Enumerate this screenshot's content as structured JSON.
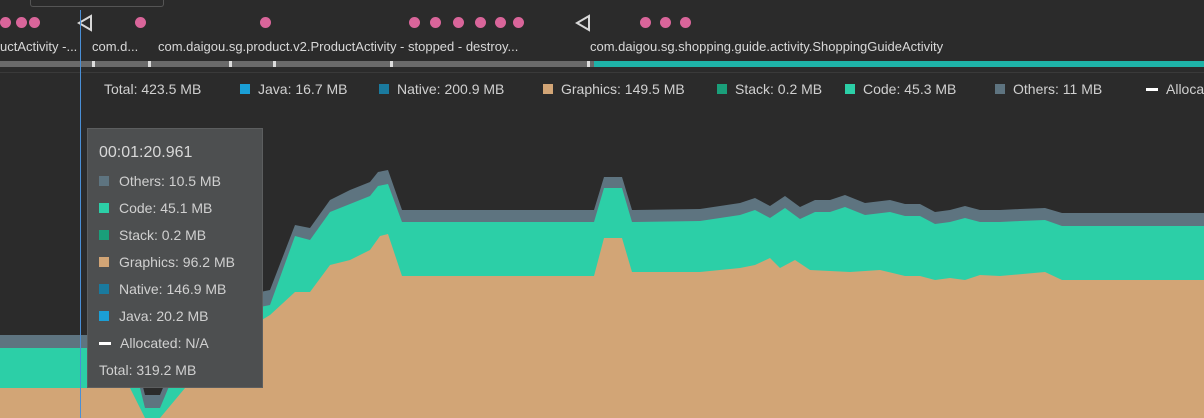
{
  "activities": [
    {
      "label": "uctActivity -..."
    },
    {
      "label": "com.d..."
    },
    {
      "label": "com.daigou.sg.product.v2.ProductActivity - stopped - destroy..."
    },
    {
      "label": "com.daigou.sg.shopping.guide.activity.ShoppingGuideActivity"
    }
  ],
  "legend": [
    {
      "label": "Total: 423.5 MB",
      "color": ""
    },
    {
      "label": "Java: 16.7 MB",
      "color": "#1a9fd6"
    },
    {
      "label": "Native: 200.9 MB",
      "color": "#1a7a9e"
    },
    {
      "label": "Graphics: 149.5 MB",
      "color": "#d2a576"
    },
    {
      "label": "Stack: 0.2 MB",
      "color": "#1a9f7a"
    },
    {
      "label": "Code: 45.3 MB",
      "color": "#2ccfa7"
    },
    {
      "label": "Others: 11 MB",
      "color": "#5e7480"
    },
    {
      "label": "Alloca",
      "color": "#ffffff"
    }
  ],
  "tooltip": {
    "time": "00:01:20.961",
    "rows": [
      {
        "label": "Others: 10.5 MB",
        "color": "#5e7480"
      },
      {
        "label": "Code: 45.1 MB",
        "color": "#2ccfa7"
      },
      {
        "label": "Stack: 0.2 MB",
        "color": "#1a9f7a"
      },
      {
        "label": "Graphics: 96.2 MB",
        "color": "#d2a576"
      },
      {
        "label": "Native: 146.9 MB",
        "color": "#1a7a9e"
      },
      {
        "label": "Java: 20.2 MB",
        "color": "#1a9fd6"
      },
      {
        "label": "Allocated: N/A",
        "color": "#ffffff"
      },
      {
        "label": "Total: 319.2 MB",
        "color": ""
      }
    ]
  },
  "colors": {
    "graphics": "#d2a576",
    "code": "#2ccfa7",
    "others": "#5e7480",
    "event_marker": "#d9659a",
    "cursor": "#4a8fd6"
  },
  "icons": {
    "event": "circle-marker",
    "back": "back-triangle-icon"
  }
}
